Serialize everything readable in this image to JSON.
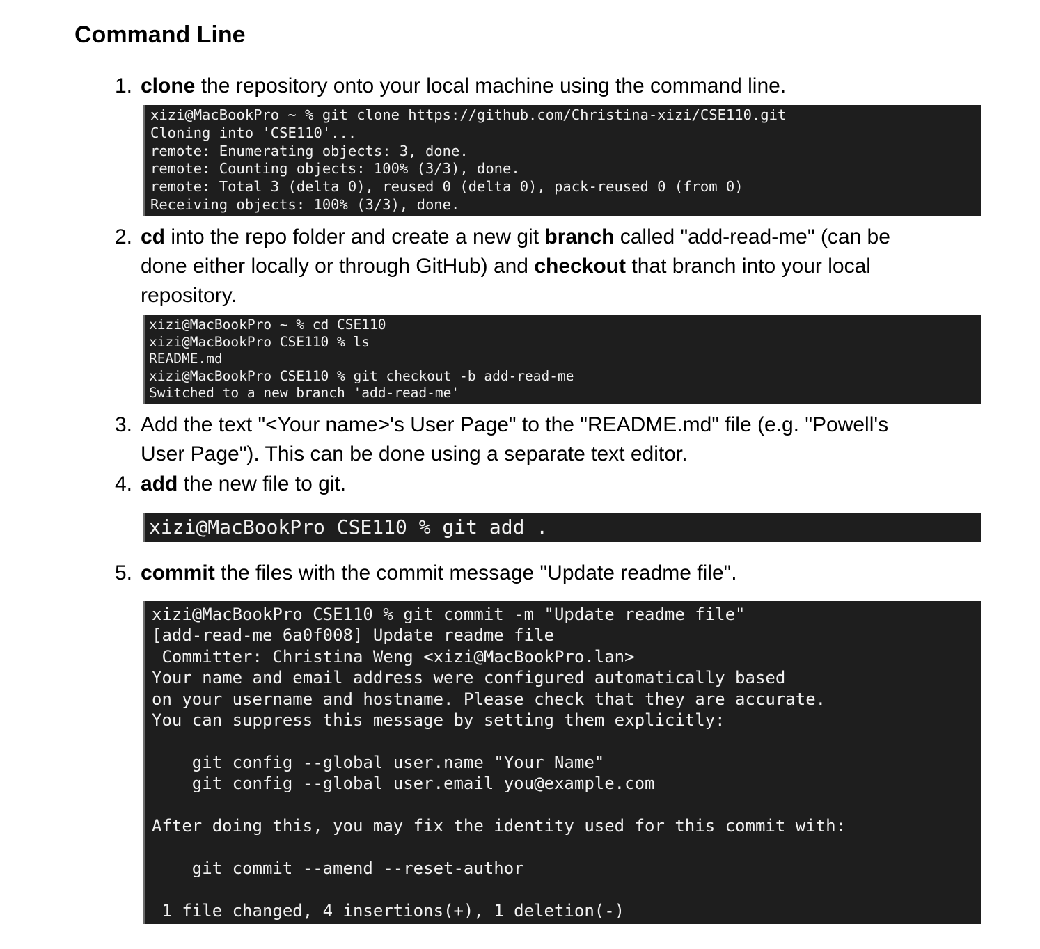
{
  "title": "Command Line",
  "steps": [
    {
      "num": "1.",
      "parts": [
        {
          "b": "clone"
        },
        {
          "t": " the repository onto your local machine using the command line."
        }
      ]
    },
    {
      "num": "2.",
      "parts": [
        {
          "b": "cd"
        },
        {
          "t": " into the repo folder and create a new git "
        },
        {
          "b": "branch"
        },
        {
          "t": " called \"add-read-me\" (can be done either locally or through GitHub) and "
        },
        {
          "b": "checkout"
        },
        {
          "t": " that branch into your local repository."
        }
      ]
    },
    {
      "num": "3.",
      "parts": [
        {
          "t": "Add the text \"<Your name>'s User Page\" to the \"README.md\" file (e.g. \"Powell's User Page\"). This can be done using a separate text editor."
        }
      ]
    },
    {
      "num": "4.",
      "parts": [
        {
          "b": "add"
        },
        {
          "t": " the new file to git."
        }
      ]
    },
    {
      "num": "5.",
      "parts": [
        {
          "b": "commit"
        },
        {
          "t": " the files with the commit message \"Update readme file\"."
        }
      ]
    }
  ],
  "terminals": {
    "clone": [
      "xizi@MacBookPro ~ % git clone https://github.com/Christina-xizi/CSE110.git",
      "Cloning into 'CSE110'...",
      "remote: Enumerating objects: 3, done.",
      "remote: Counting objects: 100% (3/3), done.",
      "remote: Total 3 (delta 0), reused 0 (delta 0), pack-reused 0 (from 0)",
      "Receiving objects: 100% (3/3), done."
    ],
    "branch": [
      "xizi@MacBookPro ~ % cd CSE110",
      "xizi@MacBookPro CSE110 % ls",
      "README.md",
      "xizi@MacBookPro CSE110 % git checkout -b add-read-me",
      "Switched to a new branch 'add-read-me'"
    ],
    "add": [
      "xizi@MacBookPro CSE110 % git add ."
    ],
    "commit": [
      "xizi@MacBookPro CSE110 % git commit -m \"Update readme file\"",
      "[add-read-me 6a0f008] Update readme file",
      " Committer: Christina Weng <xizi@MacBookPro.lan>",
      "Your name and email address were configured automatically based",
      "on your username and hostname. Please check that they are accurate.",
      "You can suppress this message by setting them explicitly:",
      "",
      "    git config --global user.name \"Your Name\"",
      "    git config --global user.email you@example.com",
      "",
      "After doing this, you may fix the identity used for this commit with:",
      "",
      "    git commit --amend --reset-author",
      "",
      " 1 file changed, 4 insertions(+), 1 deletion(-)"
    ]
  }
}
